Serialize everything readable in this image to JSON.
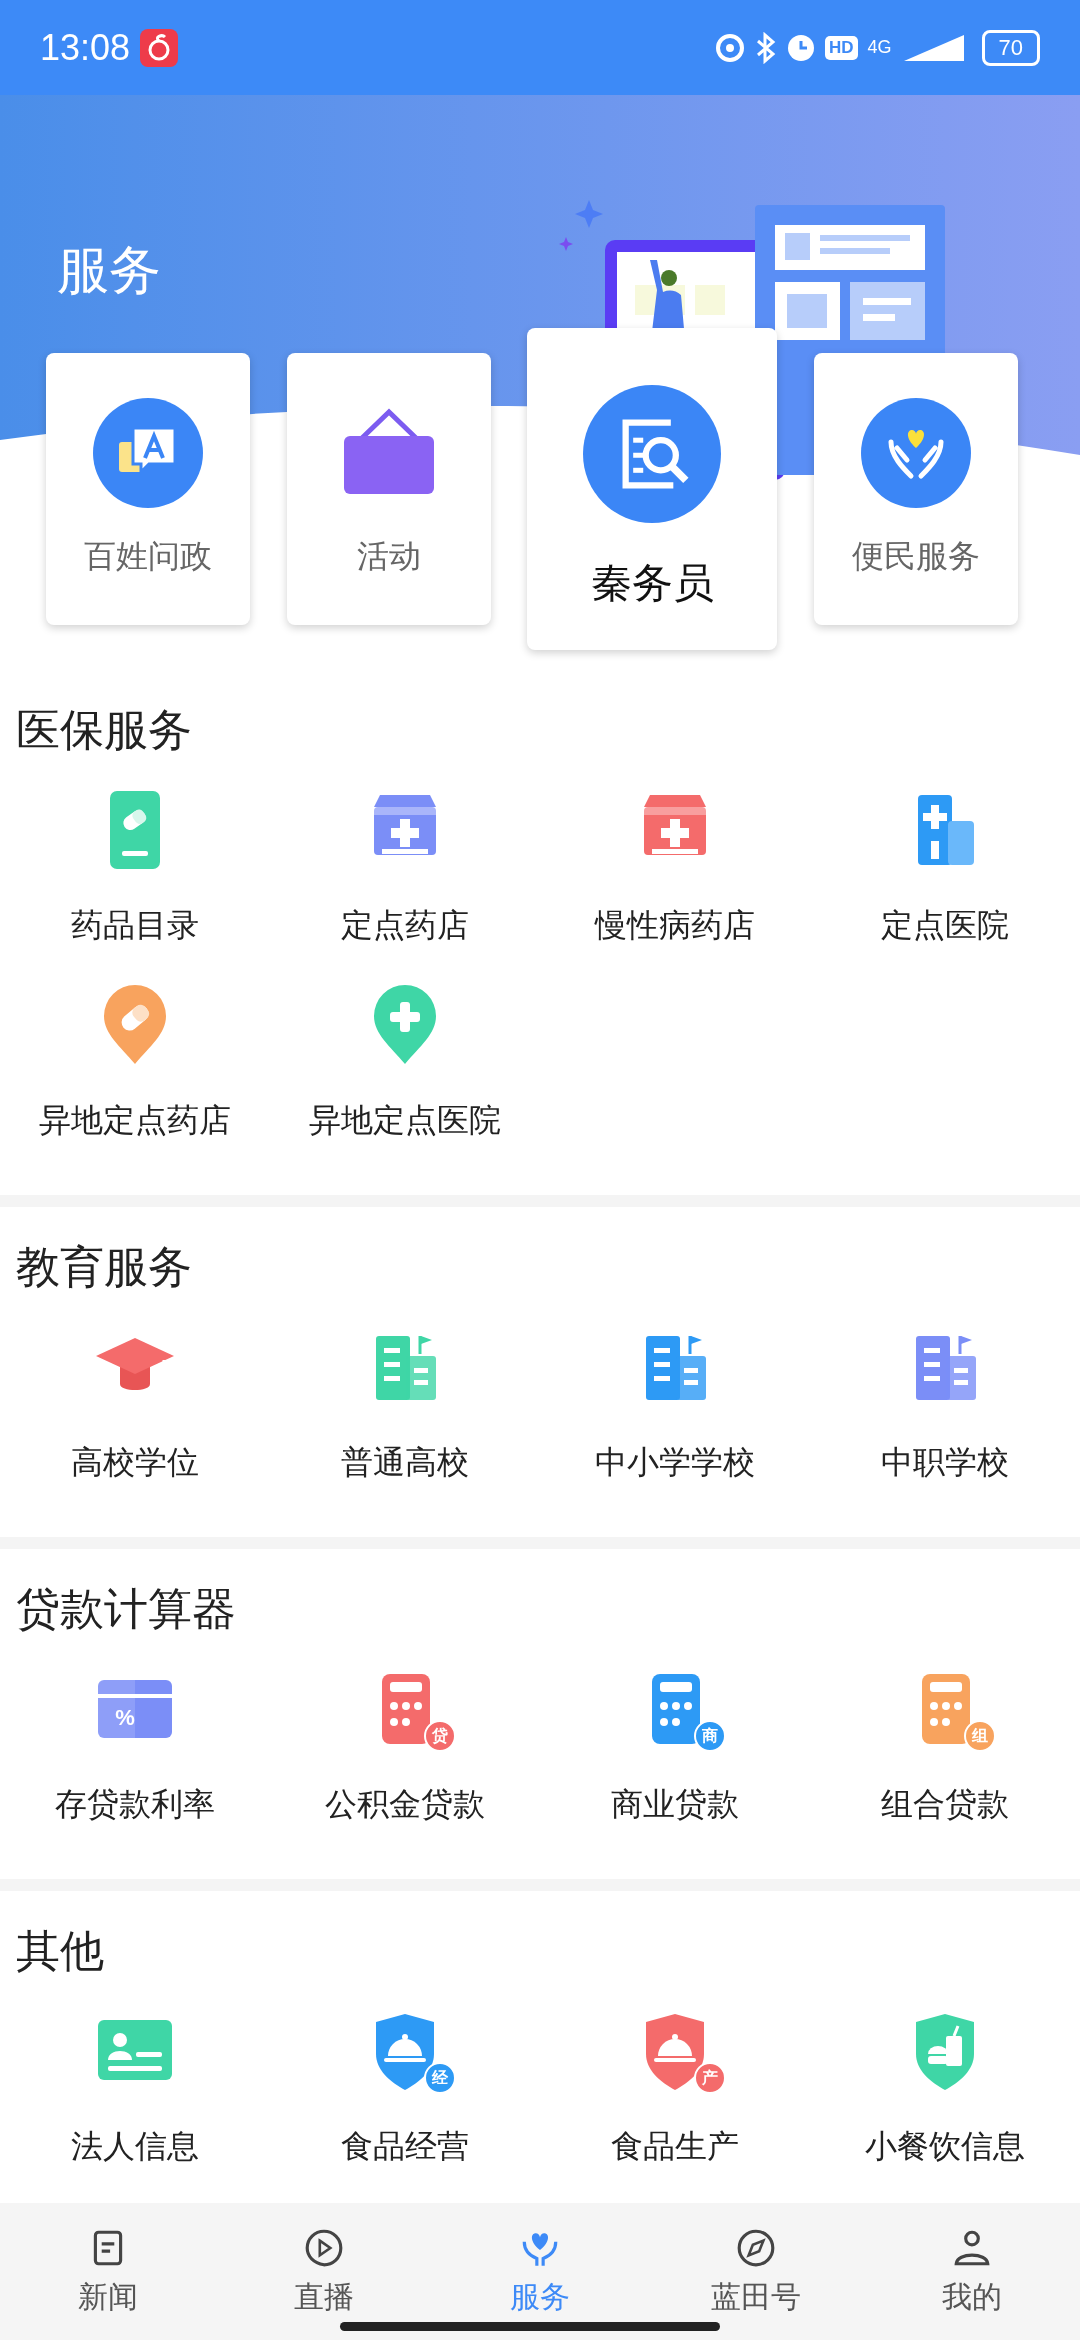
{
  "status_bar": {
    "time": "13:08",
    "hd": "HD",
    "network": "4G",
    "battery": "70"
  },
  "header": {
    "title": "服务"
  },
  "quick_cards": [
    {
      "label": "百姓问政",
      "selected": false
    },
    {
      "label": "活动",
      "selected": false
    },
    {
      "label": "秦务员",
      "selected": true
    },
    {
      "label": "便民服务",
      "selected": false
    }
  ],
  "sections": [
    {
      "title": "医保服务",
      "items": [
        {
          "label": "药品目录"
        },
        {
          "label": "定点药店"
        },
        {
          "label": "慢性病药店"
        },
        {
          "label": "定点医院"
        },
        {
          "label": "异地定点药店"
        },
        {
          "label": "异地定点医院"
        }
      ]
    },
    {
      "title": "教育服务",
      "items": [
        {
          "label": "高校学位"
        },
        {
          "label": "普通高校"
        },
        {
          "label": "中小学学校"
        },
        {
          "label": "中职学校"
        }
      ]
    },
    {
      "title": "贷款计算器",
      "items": [
        {
          "label": "存贷款利率",
          "badge": "%"
        },
        {
          "label": "公积金贷款",
          "badge": "贷"
        },
        {
          "label": "商业贷款",
          "badge": "商"
        },
        {
          "label": "组合贷款",
          "badge": "组"
        }
      ]
    },
    {
      "title": "其他",
      "items": [
        {
          "label": "法人信息"
        },
        {
          "label": "食品经营",
          "badge": "经"
        },
        {
          "label": "食品生产",
          "badge": "产"
        },
        {
          "label": "小餐饮信息"
        }
      ]
    }
  ],
  "tab_bar": [
    {
      "label": "新闻",
      "selected": false
    },
    {
      "label": "直播",
      "selected": false
    },
    {
      "label": "服务",
      "selected": true
    },
    {
      "label": "蓝田号",
      "selected": false
    },
    {
      "label": "我的",
      "selected": false
    }
  ]
}
